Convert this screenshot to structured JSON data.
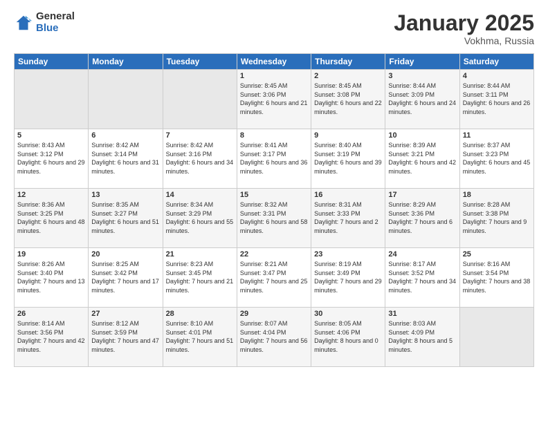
{
  "header": {
    "logo_general": "General",
    "logo_blue": "Blue",
    "month_title": "January 2025",
    "location": "Vokhma, Russia"
  },
  "weekdays": [
    "Sunday",
    "Monday",
    "Tuesday",
    "Wednesday",
    "Thursday",
    "Friday",
    "Saturday"
  ],
  "weeks": [
    [
      {
        "day": "",
        "sunrise": "",
        "sunset": "",
        "daylight": ""
      },
      {
        "day": "",
        "sunrise": "",
        "sunset": "",
        "daylight": ""
      },
      {
        "day": "",
        "sunrise": "",
        "sunset": "",
        "daylight": ""
      },
      {
        "day": "1",
        "sunrise": "Sunrise: 8:45 AM",
        "sunset": "Sunset: 3:06 PM",
        "daylight": "Daylight: 6 hours and 21 minutes."
      },
      {
        "day": "2",
        "sunrise": "Sunrise: 8:45 AM",
        "sunset": "Sunset: 3:08 PM",
        "daylight": "Daylight: 6 hours and 22 minutes."
      },
      {
        "day": "3",
        "sunrise": "Sunrise: 8:44 AM",
        "sunset": "Sunset: 3:09 PM",
        "daylight": "Daylight: 6 hours and 24 minutes."
      },
      {
        "day": "4",
        "sunrise": "Sunrise: 8:44 AM",
        "sunset": "Sunset: 3:11 PM",
        "daylight": "Daylight: 6 hours and 26 minutes."
      }
    ],
    [
      {
        "day": "5",
        "sunrise": "Sunrise: 8:43 AM",
        "sunset": "Sunset: 3:12 PM",
        "daylight": "Daylight: 6 hours and 29 minutes."
      },
      {
        "day": "6",
        "sunrise": "Sunrise: 8:42 AM",
        "sunset": "Sunset: 3:14 PM",
        "daylight": "Daylight: 6 hours and 31 minutes."
      },
      {
        "day": "7",
        "sunrise": "Sunrise: 8:42 AM",
        "sunset": "Sunset: 3:16 PM",
        "daylight": "Daylight: 6 hours and 34 minutes."
      },
      {
        "day": "8",
        "sunrise": "Sunrise: 8:41 AM",
        "sunset": "Sunset: 3:17 PM",
        "daylight": "Daylight: 6 hours and 36 minutes."
      },
      {
        "day": "9",
        "sunrise": "Sunrise: 8:40 AM",
        "sunset": "Sunset: 3:19 PM",
        "daylight": "Daylight: 6 hours and 39 minutes."
      },
      {
        "day": "10",
        "sunrise": "Sunrise: 8:39 AM",
        "sunset": "Sunset: 3:21 PM",
        "daylight": "Daylight: 6 hours and 42 minutes."
      },
      {
        "day": "11",
        "sunrise": "Sunrise: 8:37 AM",
        "sunset": "Sunset: 3:23 PM",
        "daylight": "Daylight: 6 hours and 45 minutes."
      }
    ],
    [
      {
        "day": "12",
        "sunrise": "Sunrise: 8:36 AM",
        "sunset": "Sunset: 3:25 PM",
        "daylight": "Daylight: 6 hours and 48 minutes."
      },
      {
        "day": "13",
        "sunrise": "Sunrise: 8:35 AM",
        "sunset": "Sunset: 3:27 PM",
        "daylight": "Daylight: 6 hours and 51 minutes."
      },
      {
        "day": "14",
        "sunrise": "Sunrise: 8:34 AM",
        "sunset": "Sunset: 3:29 PM",
        "daylight": "Daylight: 6 hours and 55 minutes."
      },
      {
        "day": "15",
        "sunrise": "Sunrise: 8:32 AM",
        "sunset": "Sunset: 3:31 PM",
        "daylight": "Daylight: 6 hours and 58 minutes."
      },
      {
        "day": "16",
        "sunrise": "Sunrise: 8:31 AM",
        "sunset": "Sunset: 3:33 PM",
        "daylight": "Daylight: 7 hours and 2 minutes."
      },
      {
        "day": "17",
        "sunrise": "Sunrise: 8:29 AM",
        "sunset": "Sunset: 3:36 PM",
        "daylight": "Daylight: 7 hours and 6 minutes."
      },
      {
        "day": "18",
        "sunrise": "Sunrise: 8:28 AM",
        "sunset": "Sunset: 3:38 PM",
        "daylight": "Daylight: 7 hours and 9 minutes."
      }
    ],
    [
      {
        "day": "19",
        "sunrise": "Sunrise: 8:26 AM",
        "sunset": "Sunset: 3:40 PM",
        "daylight": "Daylight: 7 hours and 13 minutes."
      },
      {
        "day": "20",
        "sunrise": "Sunrise: 8:25 AM",
        "sunset": "Sunset: 3:42 PM",
        "daylight": "Daylight: 7 hours and 17 minutes."
      },
      {
        "day": "21",
        "sunrise": "Sunrise: 8:23 AM",
        "sunset": "Sunset: 3:45 PM",
        "daylight": "Daylight: 7 hours and 21 minutes."
      },
      {
        "day": "22",
        "sunrise": "Sunrise: 8:21 AM",
        "sunset": "Sunset: 3:47 PM",
        "daylight": "Daylight: 7 hours and 25 minutes."
      },
      {
        "day": "23",
        "sunrise": "Sunrise: 8:19 AM",
        "sunset": "Sunset: 3:49 PM",
        "daylight": "Daylight: 7 hours and 29 minutes."
      },
      {
        "day": "24",
        "sunrise": "Sunrise: 8:17 AM",
        "sunset": "Sunset: 3:52 PM",
        "daylight": "Daylight: 7 hours and 34 minutes."
      },
      {
        "day": "25",
        "sunrise": "Sunrise: 8:16 AM",
        "sunset": "Sunset: 3:54 PM",
        "daylight": "Daylight: 7 hours and 38 minutes."
      }
    ],
    [
      {
        "day": "26",
        "sunrise": "Sunrise: 8:14 AM",
        "sunset": "Sunset: 3:56 PM",
        "daylight": "Daylight: 7 hours and 42 minutes."
      },
      {
        "day": "27",
        "sunrise": "Sunrise: 8:12 AM",
        "sunset": "Sunset: 3:59 PM",
        "daylight": "Daylight: 7 hours and 47 minutes."
      },
      {
        "day": "28",
        "sunrise": "Sunrise: 8:10 AM",
        "sunset": "Sunset: 4:01 PM",
        "daylight": "Daylight: 7 hours and 51 minutes."
      },
      {
        "day": "29",
        "sunrise": "Sunrise: 8:07 AM",
        "sunset": "Sunset: 4:04 PM",
        "daylight": "Daylight: 7 hours and 56 minutes."
      },
      {
        "day": "30",
        "sunrise": "Sunrise: 8:05 AM",
        "sunset": "Sunset: 4:06 PM",
        "daylight": "Daylight: 8 hours and 0 minutes."
      },
      {
        "day": "31",
        "sunrise": "Sunrise: 8:03 AM",
        "sunset": "Sunset: 4:09 PM",
        "daylight": "Daylight: 8 hours and 5 minutes."
      },
      {
        "day": "",
        "sunrise": "",
        "sunset": "",
        "daylight": ""
      }
    ]
  ]
}
